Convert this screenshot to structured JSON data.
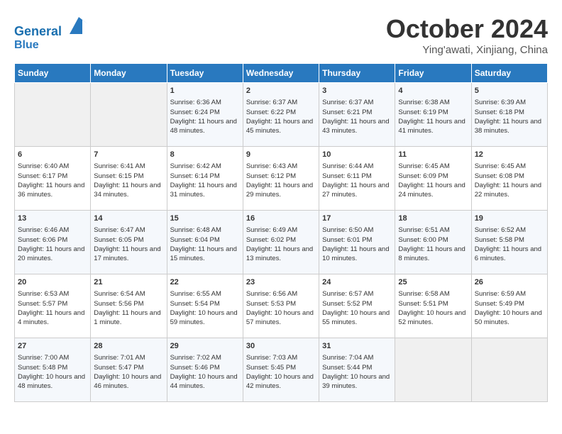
{
  "header": {
    "logo_line1": "General",
    "logo_line2": "Blue",
    "month": "October 2024",
    "location": "Ying'awati, Xinjiang, China"
  },
  "weekdays": [
    "Sunday",
    "Monday",
    "Tuesday",
    "Wednesday",
    "Thursday",
    "Friday",
    "Saturday"
  ],
  "weeks": [
    [
      {
        "day": "",
        "info": ""
      },
      {
        "day": "",
        "info": ""
      },
      {
        "day": "1",
        "info": "Sunrise: 6:36 AM\nSunset: 6:24 PM\nDaylight: 11 hours and 48 minutes."
      },
      {
        "day": "2",
        "info": "Sunrise: 6:37 AM\nSunset: 6:22 PM\nDaylight: 11 hours and 45 minutes."
      },
      {
        "day": "3",
        "info": "Sunrise: 6:37 AM\nSunset: 6:21 PM\nDaylight: 11 hours and 43 minutes."
      },
      {
        "day": "4",
        "info": "Sunrise: 6:38 AM\nSunset: 6:19 PM\nDaylight: 11 hours and 41 minutes."
      },
      {
        "day": "5",
        "info": "Sunrise: 6:39 AM\nSunset: 6:18 PM\nDaylight: 11 hours and 38 minutes."
      }
    ],
    [
      {
        "day": "6",
        "info": "Sunrise: 6:40 AM\nSunset: 6:17 PM\nDaylight: 11 hours and 36 minutes."
      },
      {
        "day": "7",
        "info": "Sunrise: 6:41 AM\nSunset: 6:15 PM\nDaylight: 11 hours and 34 minutes."
      },
      {
        "day": "8",
        "info": "Sunrise: 6:42 AM\nSunset: 6:14 PM\nDaylight: 11 hours and 31 minutes."
      },
      {
        "day": "9",
        "info": "Sunrise: 6:43 AM\nSunset: 6:12 PM\nDaylight: 11 hours and 29 minutes."
      },
      {
        "day": "10",
        "info": "Sunrise: 6:44 AM\nSunset: 6:11 PM\nDaylight: 11 hours and 27 minutes."
      },
      {
        "day": "11",
        "info": "Sunrise: 6:45 AM\nSunset: 6:09 PM\nDaylight: 11 hours and 24 minutes."
      },
      {
        "day": "12",
        "info": "Sunrise: 6:45 AM\nSunset: 6:08 PM\nDaylight: 11 hours and 22 minutes."
      }
    ],
    [
      {
        "day": "13",
        "info": "Sunrise: 6:46 AM\nSunset: 6:06 PM\nDaylight: 11 hours and 20 minutes."
      },
      {
        "day": "14",
        "info": "Sunrise: 6:47 AM\nSunset: 6:05 PM\nDaylight: 11 hours and 17 minutes."
      },
      {
        "day": "15",
        "info": "Sunrise: 6:48 AM\nSunset: 6:04 PM\nDaylight: 11 hours and 15 minutes."
      },
      {
        "day": "16",
        "info": "Sunrise: 6:49 AM\nSunset: 6:02 PM\nDaylight: 11 hours and 13 minutes."
      },
      {
        "day": "17",
        "info": "Sunrise: 6:50 AM\nSunset: 6:01 PM\nDaylight: 11 hours and 10 minutes."
      },
      {
        "day": "18",
        "info": "Sunrise: 6:51 AM\nSunset: 6:00 PM\nDaylight: 11 hours and 8 minutes."
      },
      {
        "day": "19",
        "info": "Sunrise: 6:52 AM\nSunset: 5:58 PM\nDaylight: 11 hours and 6 minutes."
      }
    ],
    [
      {
        "day": "20",
        "info": "Sunrise: 6:53 AM\nSunset: 5:57 PM\nDaylight: 11 hours and 4 minutes."
      },
      {
        "day": "21",
        "info": "Sunrise: 6:54 AM\nSunset: 5:56 PM\nDaylight: 11 hours and 1 minute."
      },
      {
        "day": "22",
        "info": "Sunrise: 6:55 AM\nSunset: 5:54 PM\nDaylight: 10 hours and 59 minutes."
      },
      {
        "day": "23",
        "info": "Sunrise: 6:56 AM\nSunset: 5:53 PM\nDaylight: 10 hours and 57 minutes."
      },
      {
        "day": "24",
        "info": "Sunrise: 6:57 AM\nSunset: 5:52 PM\nDaylight: 10 hours and 55 minutes."
      },
      {
        "day": "25",
        "info": "Sunrise: 6:58 AM\nSunset: 5:51 PM\nDaylight: 10 hours and 52 minutes."
      },
      {
        "day": "26",
        "info": "Sunrise: 6:59 AM\nSunset: 5:49 PM\nDaylight: 10 hours and 50 minutes."
      }
    ],
    [
      {
        "day": "27",
        "info": "Sunrise: 7:00 AM\nSunset: 5:48 PM\nDaylight: 10 hours and 48 minutes."
      },
      {
        "day": "28",
        "info": "Sunrise: 7:01 AM\nSunset: 5:47 PM\nDaylight: 10 hours and 46 minutes."
      },
      {
        "day": "29",
        "info": "Sunrise: 7:02 AM\nSunset: 5:46 PM\nDaylight: 10 hours and 44 minutes."
      },
      {
        "day": "30",
        "info": "Sunrise: 7:03 AM\nSunset: 5:45 PM\nDaylight: 10 hours and 42 minutes."
      },
      {
        "day": "31",
        "info": "Sunrise: 7:04 AM\nSunset: 5:44 PM\nDaylight: 10 hours and 39 minutes."
      },
      {
        "day": "",
        "info": ""
      },
      {
        "day": "",
        "info": ""
      }
    ]
  ]
}
